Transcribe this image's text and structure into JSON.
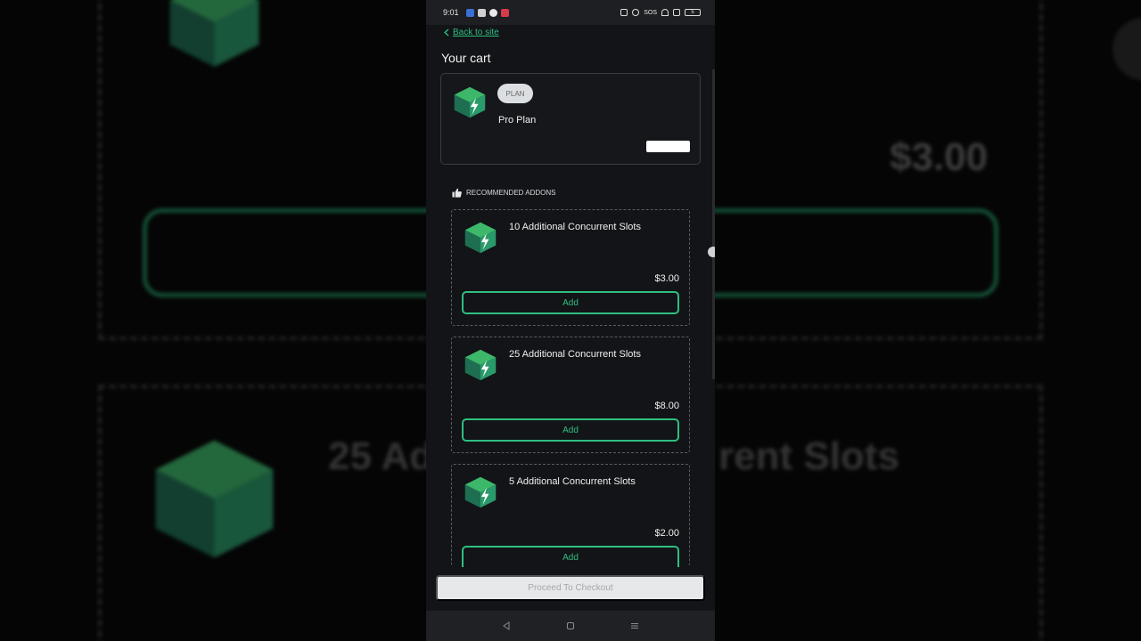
{
  "status_bar": {
    "time": "9:01",
    "signal_text": "SOS",
    "battery": "5"
  },
  "nav": {
    "back_label": "Back to site"
  },
  "cart": {
    "title": "Your cart",
    "plan": {
      "badge": "PLAN",
      "name": "Pro Plan"
    }
  },
  "recommended": {
    "label": "RECOMMENDED ADDONS",
    "items": [
      {
        "name": "10 Additional Concurrent Slots",
        "price": "$3.00",
        "button": "Add"
      },
      {
        "name": "25 Additional Concurrent Slots",
        "price": "$8.00",
        "button": "Add"
      },
      {
        "name": "5 Additional Concurrent Slots",
        "price": "$2.00",
        "button": "Add"
      }
    ]
  },
  "checkout": {
    "label": "Proceed To Checkout"
  },
  "background": {
    "price": "$3.00",
    "text_left": "25 Ad",
    "text_right": "rent Slots"
  },
  "colors": {
    "accent": "#2fbf7e",
    "cube_top": "#3db86a",
    "cube_left": "#1e7a57",
    "cube_right": "#2a9a6a"
  }
}
